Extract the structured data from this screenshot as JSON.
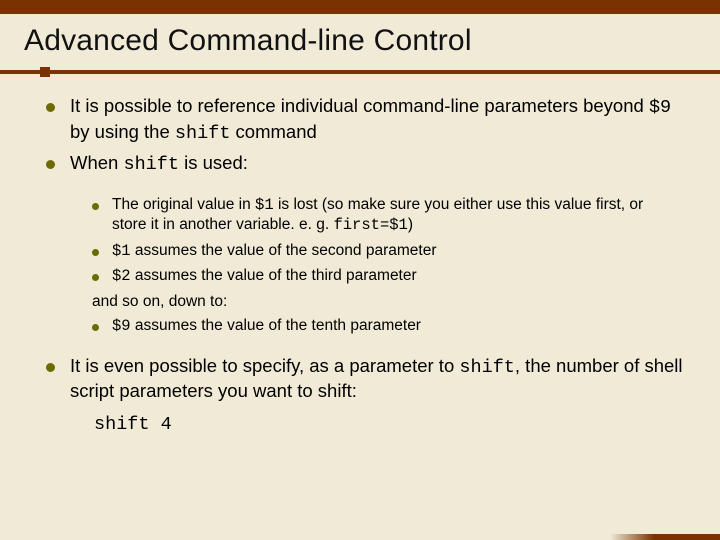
{
  "title": "Advanced Command-line Control",
  "main": {
    "b1": {
      "t1": "It is possible to reference individual command-line parameters beyond ",
      "c1": "$9",
      "t2": " by using the ",
      "c2": "shift",
      "t3": " command"
    },
    "b2": {
      "t1": "When ",
      "c1": "shift",
      "t2": " is used:"
    },
    "b3": {
      "t1": "It is even possible to specify, as a parameter to ",
      "c1": "shift",
      "t2": ", the number of shell script parameters you want to shift:"
    }
  },
  "sub": {
    "s1": {
      "t1": "The original value in ",
      "c1": "$1",
      "t2": " is lost (so make sure you either use this value first, or store it in another variable.  e. g. ",
      "c2": "first=$1",
      "t3": ")"
    },
    "s2": {
      "c1": "$1",
      "t1": " assumes the value of the second parameter"
    },
    "s3": {
      "c1": "$2",
      "t1": " assumes the value of the third parameter"
    },
    "inter": "and so on, down to:",
    "s4": {
      "c1": "$9",
      "t1": " assumes the value of the tenth parameter"
    }
  },
  "code": "shift 4"
}
